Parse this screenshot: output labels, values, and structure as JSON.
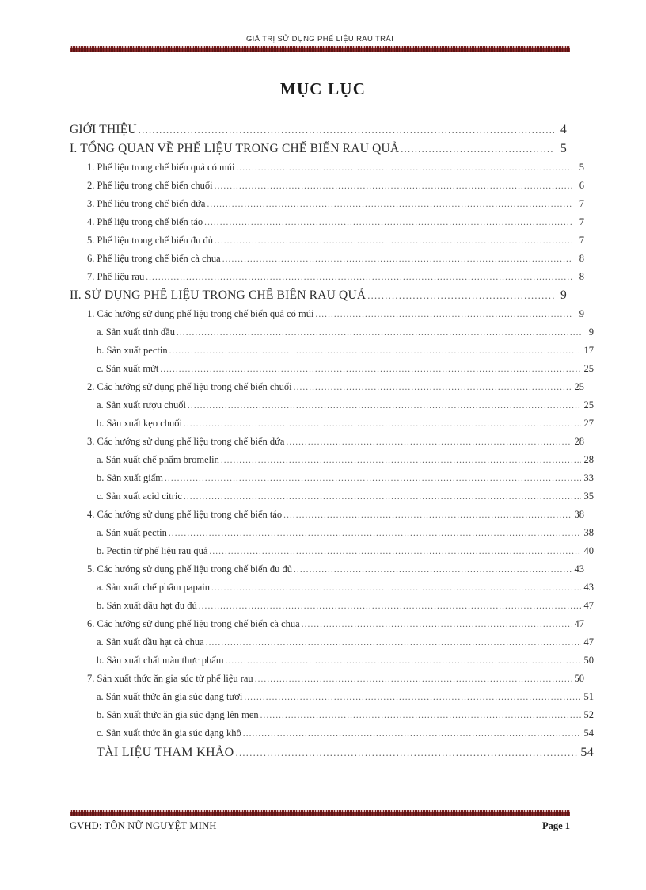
{
  "header": {
    "running_head": "GIÁ TRỊ SỬ DỤNG  PHẾ  LIỆU RAU TRÁI"
  },
  "title": "MỤC LỤC",
  "toc": {
    "entries": [
      {
        "level": 1,
        "label": "GIỚI THIỆU",
        "page": "4"
      },
      {
        "level": 1,
        "label": "I. TỔNG QUAN VỀ PHẾ LIỆU TRONG CHẾ BIẾN RAU QUẢ",
        "page": "5"
      },
      {
        "level": 2,
        "label": "1. Phế liệu  trong  chế biến  quả có múi",
        "page": "5"
      },
      {
        "level": 2,
        "label": "2. Phế liệu  trong  chế biến  chuối",
        "page": "6"
      },
      {
        "level": 2,
        "label": "3. Phế liệu  trong  chế biến  dứa",
        "page": "7"
      },
      {
        "level": 2,
        "label": "4. Phế liệu  trong  chế biến  táo",
        "page": "7"
      },
      {
        "level": 2,
        "label": "5. Phế liệu  trong  chế biến  đu đủ",
        "page": "7"
      },
      {
        "level": 2,
        "label": "6. Phế liệu  trong  chế biến  cà chua",
        "page": "8"
      },
      {
        "level": 2,
        "label": "7. Phế liệu  rau",
        "page": "8"
      },
      {
        "level": 1,
        "label": "II. SỬ DỤNG PHẾ LIỆU  TRONG CHẾ BIẾN RAU QUẢ",
        "page": "9"
      },
      {
        "level": 2,
        "label": "1. Các hướng  sử dụng  phế liệu  trong  chế biến  quả có múi",
        "page": "9"
      },
      {
        "level": 3,
        "label": "a. Sản xuất tinh  dầu",
        "page": "9"
      },
      {
        "level": 3,
        "label": "b. Sản xuất pectin",
        "page": "17"
      },
      {
        "level": 3,
        "label": "c. Sản xuất mứt",
        "page": "25"
      },
      {
        "level": 2,
        "label": "2. Các hướng  sử dụng  phế liệu  trong  chế biến  chuối",
        "page": "25"
      },
      {
        "level": 3,
        "label": "a. Sản xuất rượu chuối",
        "page": "25"
      },
      {
        "level": 3,
        "label": "b. Sản xuất kẹo chuối",
        "page": "27"
      },
      {
        "level": 2,
        "label": "3. Các hướng  sử dụng  phế liệu  trong  chế biến  dứa",
        "page": "28"
      },
      {
        "level": 3,
        "label": "a. Sản xuất  chế phẩm bromelin",
        "page": "28"
      },
      {
        "level": 3,
        "label": "b. Sản xuất  giấm",
        "page": "33"
      },
      {
        "level": 3,
        "label": "c. Sản xuất  acid citric",
        "page": "35"
      },
      {
        "level": 2,
        "label": "4. Các hướng  sử dụng  phế liệu  trong  chế biến  táo",
        "page": "38"
      },
      {
        "level": 3,
        "label": "a. Sản xuất  pectin",
        "page": "38"
      },
      {
        "level": 3,
        "label": "b. Pectin  từ phế liệu  rau quả",
        "page": "40"
      },
      {
        "level": 2,
        "label": "5. Các hướng  sử dụng  phế liệu  trong  chế biến  đu đủ",
        "page": "43"
      },
      {
        "level": 3,
        "label": "a. Sản xuất  chế phẩm papain",
        "page": "43"
      },
      {
        "level": 3,
        "label": "b. Sản xuất  dầu hạt đu đủ",
        "page": "47"
      },
      {
        "level": 2,
        "label": "6. Các hướng  sử dụng  phế liệu  trong  chế biến  cà chua",
        "page": "47"
      },
      {
        "level": 3,
        "label": "a. Sản xuất  dầu hạt cà chua",
        "page": "47"
      },
      {
        "level": 3,
        "label": "b. Sản xuất  chất màu  thực phẩm",
        "page": "50"
      },
      {
        "level": 2,
        "label": "7. Sản xuất  thức ăn gia súc từ phế liệu  rau",
        "page": "50"
      },
      {
        "level": 3,
        "label": "a. Sản xuất  thức ăn gia  súc dạng tươi",
        "page": "51"
      },
      {
        "level": 3,
        "label": "b. Sản xuất  thức ăn gia  súc dạng lên men",
        "page": "52"
      },
      {
        "level": 3,
        "label": "c. Sản xuất  thức ăn gia  súc dạng khô",
        "page": "54"
      },
      {
        "level": 0,
        "label": "TÀI LIỆU THAM KHẢO",
        "page": "54"
      }
    ]
  },
  "footer": {
    "left": "GVHD: TÔN NỮ NGUYỆT  MINH",
    "right": "Page 1"
  },
  "colors": {
    "rule_dark": "#6d1a1a",
    "rule_light": "#d8b9b9",
    "text": "#2d2d2d"
  }
}
